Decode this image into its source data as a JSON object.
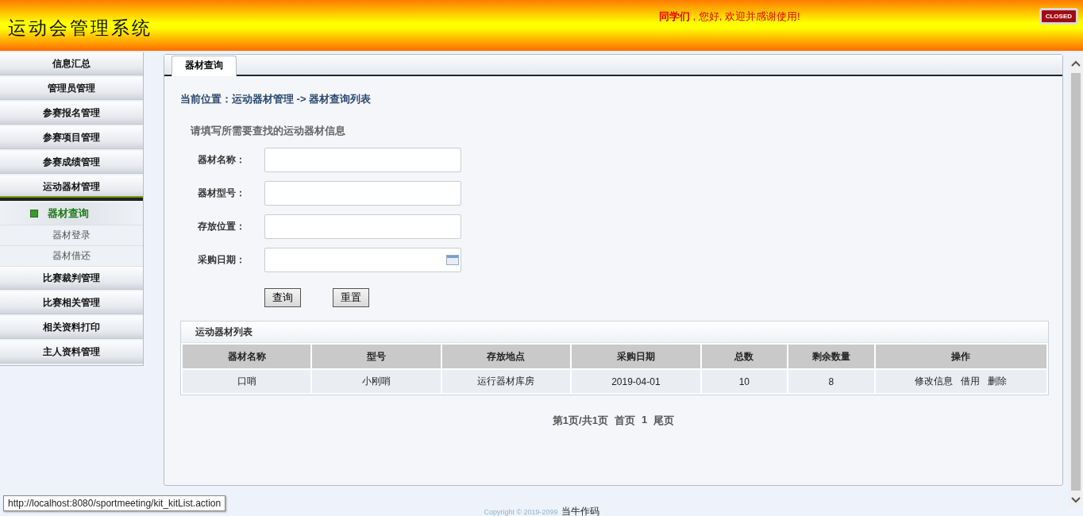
{
  "header": {
    "title": "运动会管理系统",
    "greeting_name": "同学们",
    "greeting_text": " , 您好, 欢迎并感谢使用!",
    "close_button": "CLOSED"
  },
  "sidebar": {
    "items": [
      {
        "label": "信息汇总",
        "expanded": false
      },
      {
        "label": "管理员管理",
        "expanded": false
      },
      {
        "label": "参赛报名管理",
        "expanded": false
      },
      {
        "label": "参赛项目管理",
        "expanded": false
      },
      {
        "label": "参赛成绩管理",
        "expanded": false
      },
      {
        "label": "运动器材管理",
        "expanded": true,
        "children": [
          {
            "label": "器材查询",
            "selected": true
          },
          {
            "label": "器材登录",
            "selected": false
          },
          {
            "label": "器材借还",
            "selected": false
          }
        ]
      },
      {
        "label": "比赛裁判管理",
        "expanded": false
      },
      {
        "label": "比赛相关管理",
        "expanded": false
      },
      {
        "label": "相关资料打印",
        "expanded": false
      },
      {
        "label": "主人资料管理",
        "expanded": false
      }
    ]
  },
  "tabs": [
    {
      "label": "器材查询",
      "selected": true
    }
  ],
  "breadcrumb": "当前位置：运动器材管理 -> 器材查询列表",
  "form": {
    "hint": "请填写所需要查找的运动器材信息",
    "fields": [
      {
        "label": "器材名称：",
        "kind": "text"
      },
      {
        "label": "器材型号：",
        "kind": "text"
      },
      {
        "label": "存放位置：",
        "kind": "text"
      },
      {
        "label": "采购日期：",
        "kind": "date"
      }
    ],
    "buttons": [
      "查询",
      "重置"
    ]
  },
  "table": {
    "title": "运动器材列表",
    "columns": [
      "器材名称",
      "型号",
      "存放地点",
      "采购日期",
      "总数",
      "剩余数量",
      "操作"
    ],
    "rows": [
      {
        "cells": [
          "口哨",
          "小刚哨",
          "运行器材库房",
          "2019-04-01",
          "10",
          "8"
        ],
        "actions": [
          "修改信息",
          "借用",
          "删除"
        ]
      }
    ]
  },
  "pagination": {
    "summary": "第1页/共1页",
    "first": "首页",
    "page": "1",
    "last": "尾页"
  },
  "footer": {
    "copyright": "Copyright © 2019-2099",
    "author": "当牛作码"
  },
  "status_bar": {
    "url": "http://localhost:8080/sportmeeting/kit_kitList.action"
  }
}
